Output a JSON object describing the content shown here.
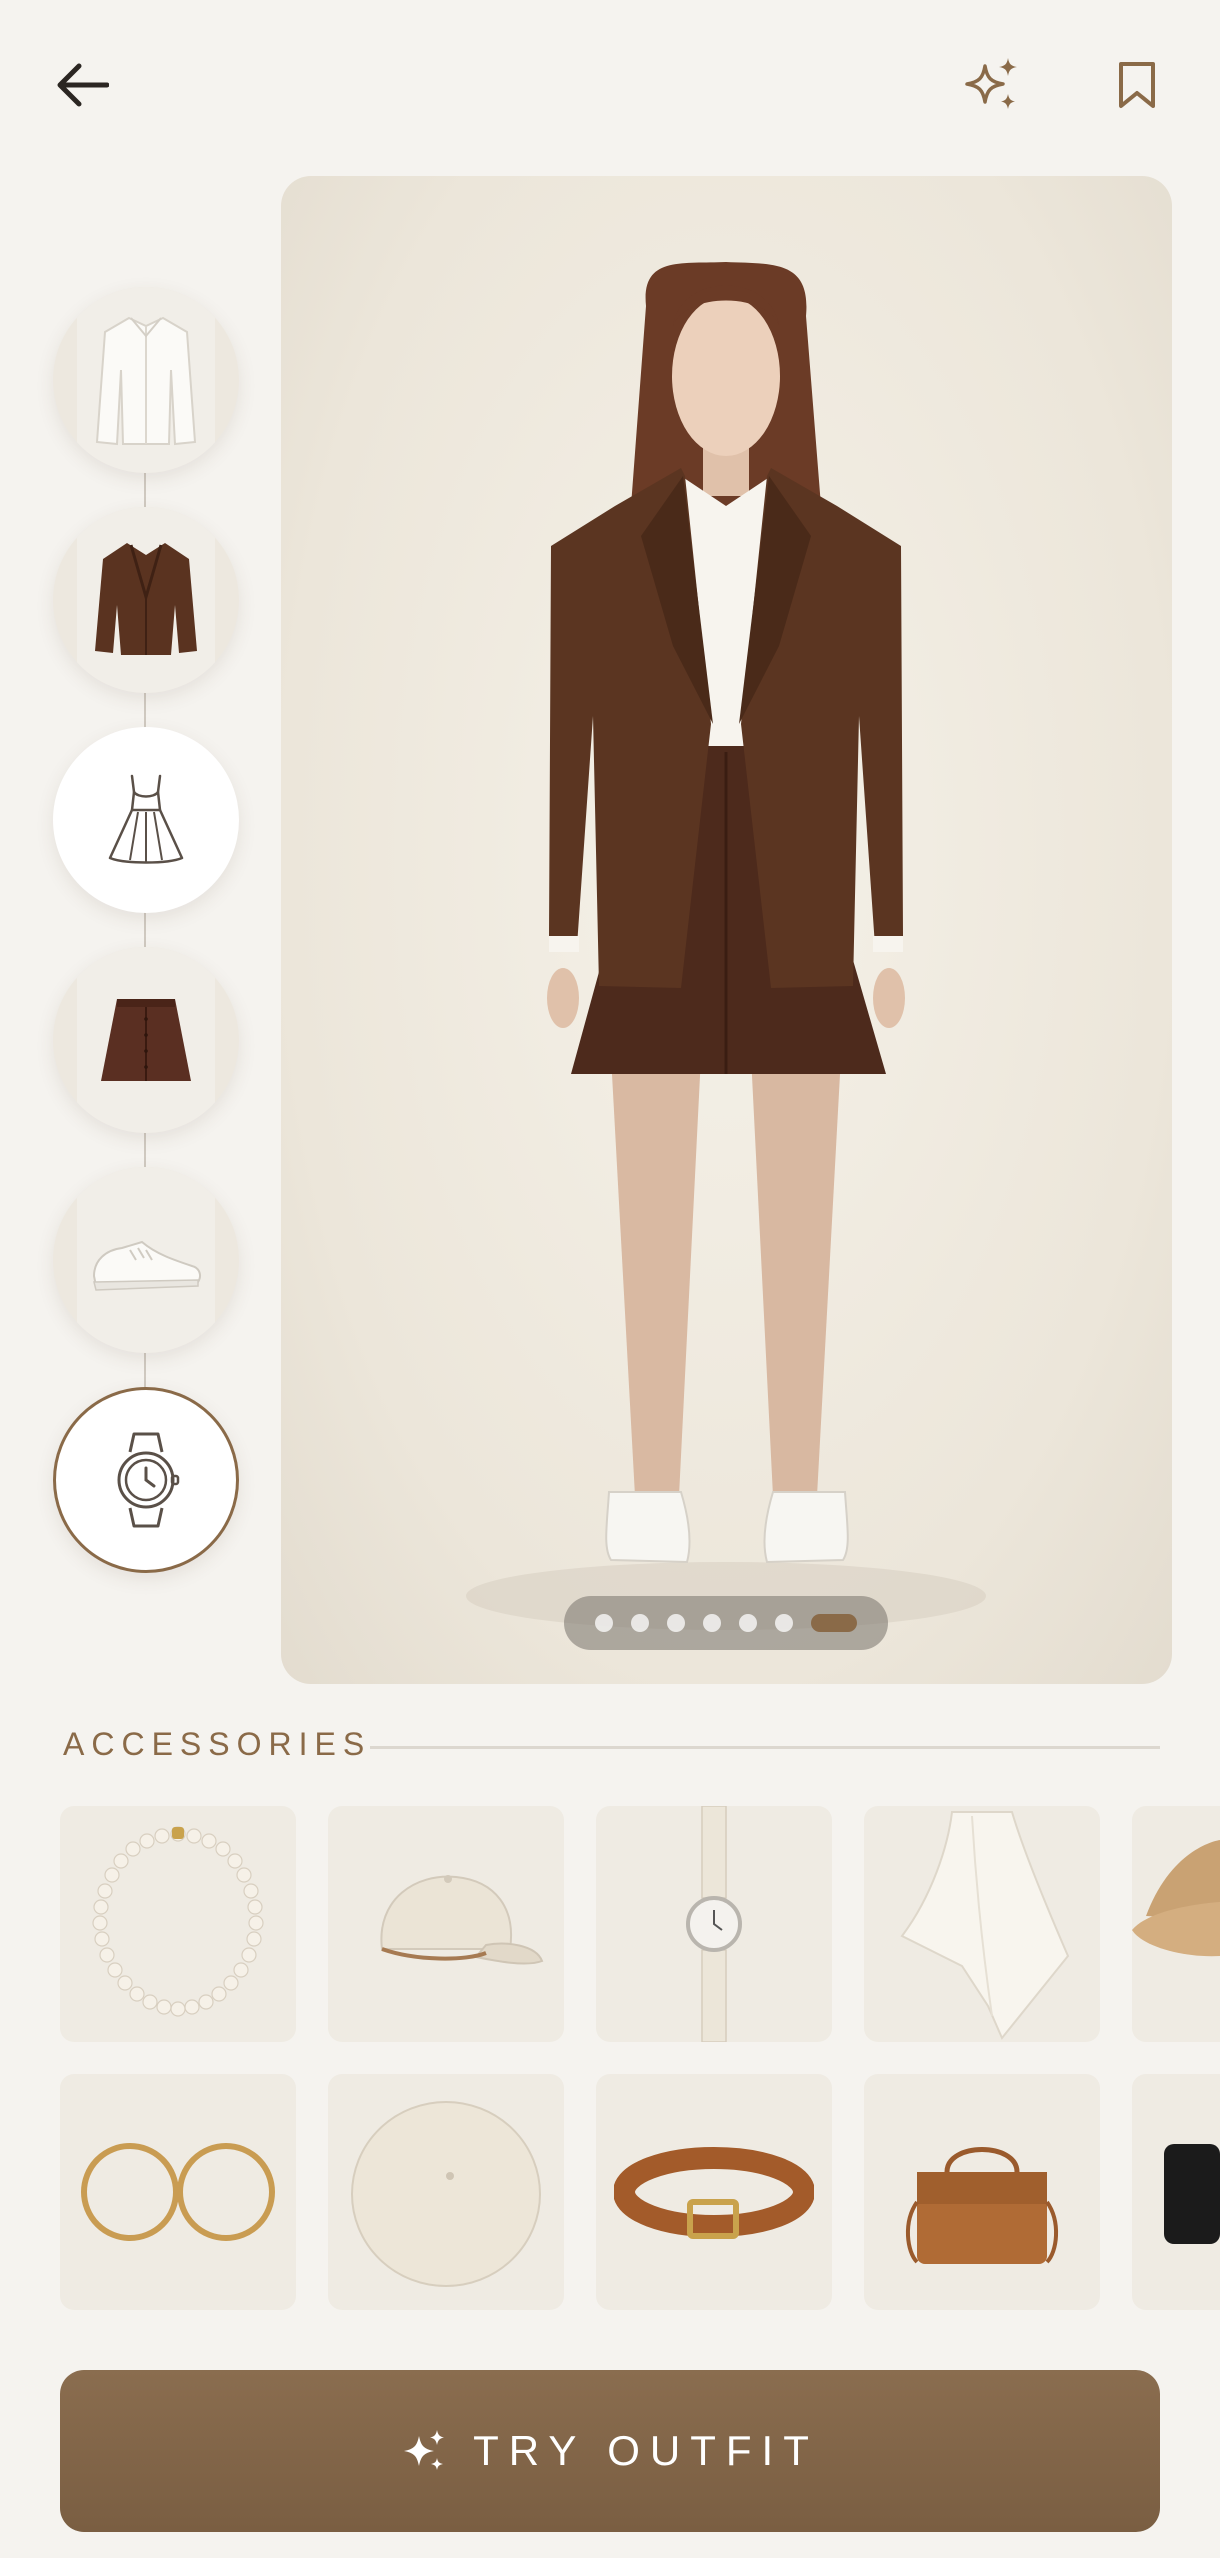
{
  "header": {
    "back_icon": "arrow-left-icon",
    "ai_icon": "sparkle-icon",
    "bookmark_icon": "bookmark-icon"
  },
  "outfit_slots": [
    {
      "name": "shirt",
      "icon": "white-shirt-image"
    },
    {
      "name": "blazer",
      "icon": "brown-blazer-image"
    },
    {
      "name": "dress",
      "icon": "dress-outline-icon"
    },
    {
      "name": "skirt",
      "icon": "brown-skirt-image"
    },
    {
      "name": "sneakers",
      "icon": "white-sneaker-image"
    },
    {
      "name": "watch",
      "icon": "watch-outline-icon",
      "selected": true
    }
  ],
  "preview": {
    "image": "model-full-outfit-photo",
    "page_count": 7,
    "active_page": 7
  },
  "accessories": {
    "title": "ACCESSORIES",
    "row1": [
      "pearl-necklace",
      "cream-cap",
      "cream-watch",
      "white-scarf",
      "straw-hat"
    ],
    "row2": [
      "gold-hoop-earrings",
      "cream-beret",
      "brown-belt",
      "tan-handbag",
      "black-bag"
    ]
  },
  "cta": {
    "label": "TRY OUTFIT",
    "icon": "sparkle-icon"
  },
  "colors": {
    "accent": "#8a6a48",
    "background": "#f5f3ef",
    "cta": "#7f6447"
  }
}
